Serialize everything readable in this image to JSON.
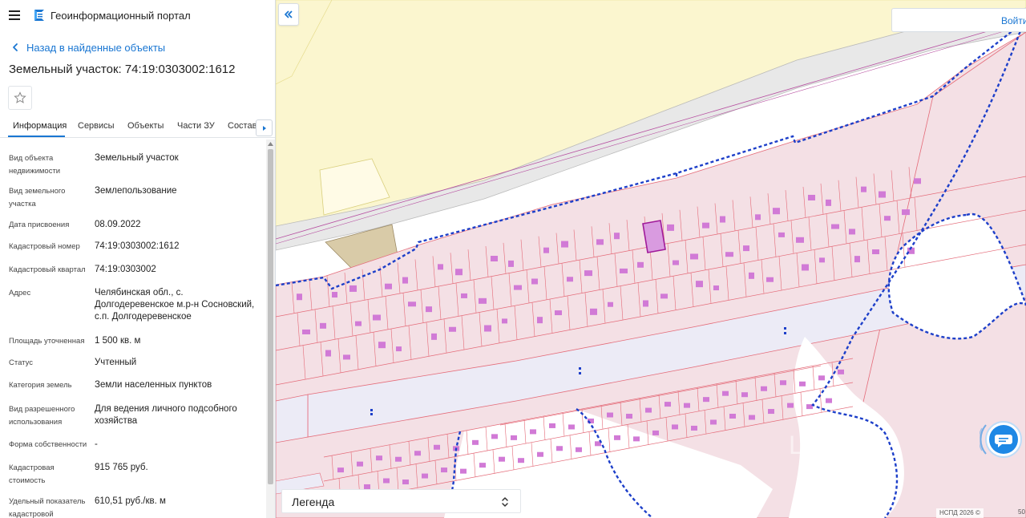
{
  "app": {
    "title": "Геоинформационный портал"
  },
  "nav": {
    "back_label": "Назад в найденные объекты"
  },
  "object": {
    "title": "Земельный участок: 74:19:0303002:1612"
  },
  "tabs": [
    {
      "label": "Информация",
      "active": true
    },
    {
      "label": "Сервисы",
      "active": false
    },
    {
      "label": "Объекты",
      "active": false
    },
    {
      "label": "Части ЗУ",
      "active": false
    },
    {
      "label": "Состав",
      "active": false
    }
  ],
  "properties": [
    {
      "label": "Вид объекта недвижимости",
      "value": "Земельный участок"
    },
    {
      "label": "Вид земельного участка",
      "value": "Землепользование"
    },
    {
      "label": "Дата присвоения",
      "value": "08.09.2022"
    },
    {
      "label": "Кадастровый номер",
      "value": "74:19:0303002:1612"
    },
    {
      "label": "Кадастровый квартал",
      "value": "74:19:0303002"
    },
    {
      "label": "Адрес",
      "value": "Челябинская обл., с. Долгодеревенское м.р-н Сосновский, с.п. Долгодеревенское"
    },
    {
      "label": "Площадь уточненная",
      "value": "1 500 кв. м"
    },
    {
      "label": "Статус",
      "value": "Учтенный"
    },
    {
      "label": "Категория земель",
      "value": "Земли населенных пунктов"
    },
    {
      "label": "Вид разрешенного использования",
      "value": "Для ведения личного подсобного хозяйства"
    },
    {
      "label": "Форма собственности",
      "value": "-"
    },
    {
      "label": "Кадастровая стоимость",
      "value": "915 765 руб."
    },
    {
      "label": "Удельный показатель кадастровой",
      "value": "610,51 руб./кв. м"
    }
  ],
  "map": {
    "login_label": "Войти",
    "legend_label": "Легенда",
    "attribution": "НСПД 2026 ©",
    "scale_fragment": "50",
    "colors": {
      "parcel_fill": "#f4dfe4",
      "parcel_stroke": "#e46a78",
      "building": "#d17ad6",
      "selected": "#a01a9a",
      "yellow_zone": "#fbf6cf",
      "road": "#ececec",
      "blue_boundary": "#1d3fc9",
      "accent": "#1976d2"
    }
  }
}
